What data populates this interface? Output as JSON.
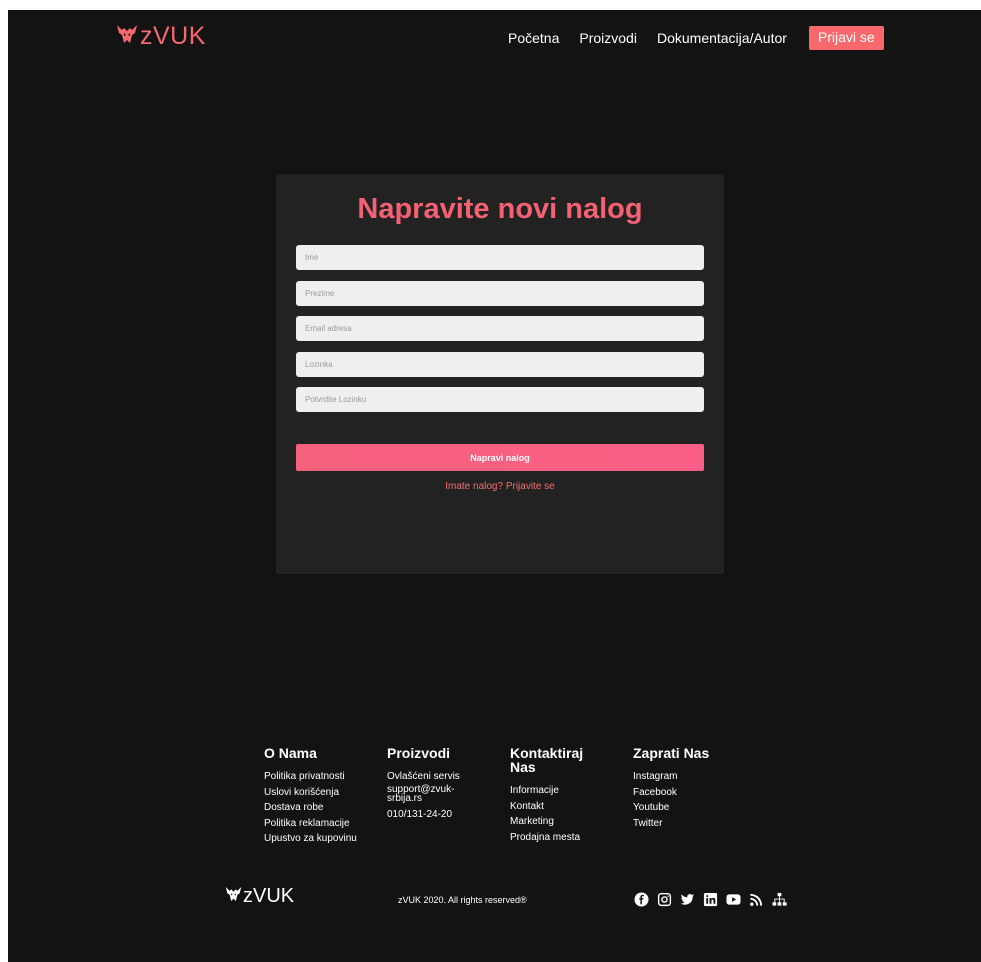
{
  "header": {
    "logo_text": "zVUK",
    "nav": {
      "home": "Početna",
      "products": "Proizvodi",
      "docs": "Dokumentacija/Autor",
      "login": "Prijavi se"
    }
  },
  "form": {
    "title": "Napravite novi nalog",
    "fields": {
      "first_name": {
        "placeholder": "Ime",
        "value": ""
      },
      "last_name": {
        "placeholder": "Prezime",
        "value": ""
      },
      "email": {
        "placeholder": "Email adresa",
        "value": ""
      },
      "password": {
        "placeholder": "Lozinka",
        "value": ""
      },
      "confirm_password": {
        "placeholder": "Potvrdite Lozinku",
        "value": ""
      }
    },
    "submit_label": "Napravi nalog",
    "login_link": "Imate nalog? Prijavite se"
  },
  "footer": {
    "about": {
      "title": "O Nama",
      "links": [
        "Politika privatnosti",
        "Uslovi korišćenja",
        "Dostava robe",
        "Politika reklamacije",
        "Upustvo za kupovinu"
      ]
    },
    "products": {
      "title": "Proizvodi",
      "links": [
        "Ovlašćeni servis",
        "support@zvuk-srbija.rs",
        "010/131-24-20"
      ]
    },
    "contact": {
      "title": "Kontaktiraj Nas",
      "links": [
        "Informacije",
        "Kontakt",
        "Marketing",
        "Prodajna mesta"
      ]
    },
    "follow": {
      "title": "Zaprati Nas",
      "links": [
        "Instagram",
        "Facebook",
        "Youtube",
        "Twitter"
      ]
    },
    "logo_text": "zVUK",
    "copyright": "zVUK 2020. All rights reserved®",
    "social_icons": [
      "facebook-icon",
      "instagram-icon",
      "twitter-icon",
      "linkedin-icon",
      "youtube-icon",
      "rss-icon",
      "sitemap-icon"
    ]
  },
  "colors": {
    "accent": "#f9686d",
    "title_pink": "#f36172",
    "page_bg": "#131313",
    "card_bg": "#222222"
  }
}
